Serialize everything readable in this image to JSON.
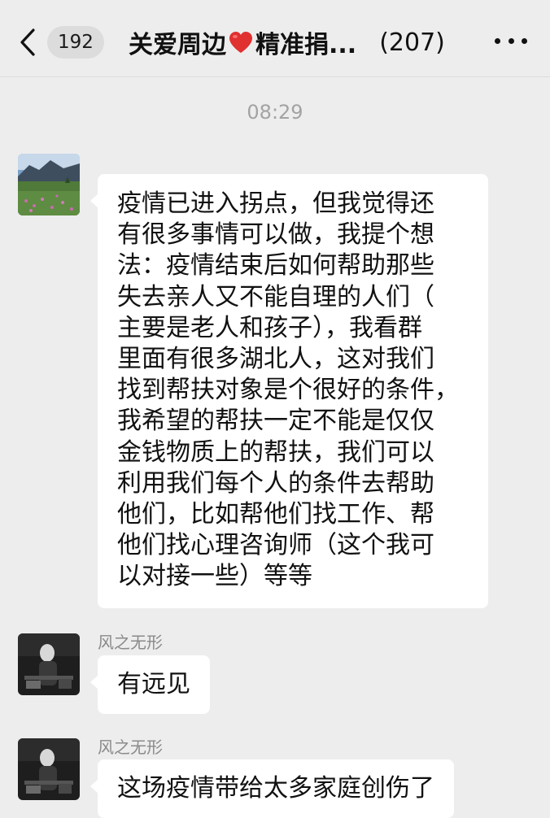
{
  "header": {
    "unread_count": "192",
    "title": "关爱周边",
    "title_suffix": "精准捐...",
    "member_count": "(207)",
    "heart_color": "#e0302f"
  },
  "timestamp": "08:29",
  "messages": [
    {
      "sender": "",
      "avatar": "landscape-avatar",
      "lines": [
        "疫情已进入拐点，但我觉得还",
        "有很多事情可以做，我提个想",
        "法：疫情结束后如何帮助那些",
        "失去亲人又不能自理的人们（",
        "主要是老人和孩子），我看群",
        "里面有很多湖北人，这对我们",
        "找到帮扶对象是个很好的条件，",
        "我希望的帮扶一定不能是仅仅",
        "金钱物质上的帮扶，我们可以",
        "利用我们每个人的条件去帮助",
        "他们，比如帮他们找工作、帮",
        "他们找心理咨询师（这个我可",
        "以对接一些）等等"
      ]
    },
    {
      "sender": "风之无形",
      "avatar": "dark-portrait-avatar",
      "text": "有远见"
    },
    {
      "sender": "风之无形",
      "avatar": "dark-portrait-avatar",
      "text": "这场疫情带给太多家庭创伤了"
    }
  ]
}
